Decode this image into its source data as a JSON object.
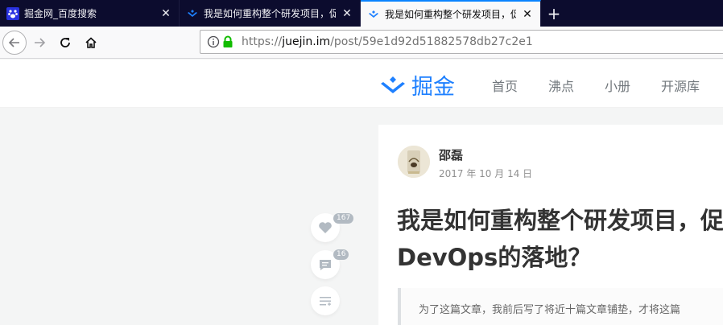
{
  "browser": {
    "tabs": [
      {
        "title": "掘金网_百度搜索",
        "favicon": "baidu-paw-icon",
        "active": false
      },
      {
        "title": "我是如何重构整个研发项目，促",
        "favicon": "juejin-icon",
        "active": false
      },
      {
        "title": "我是如何重构整个研发项目，促",
        "favicon": "juejin-icon",
        "active": true
      }
    ],
    "close_glyph": "✕",
    "new_tab_glyph": "+",
    "url_prefix": "https://",
    "url_domain": "juejin.im",
    "url_path": "/post/59e1d92d51882578db27c2e1"
  },
  "site": {
    "logo_text": "掘金",
    "nav": [
      "首页",
      "沸点",
      "小册",
      "开源库"
    ],
    "brand_color": "#1e80ff"
  },
  "sidebar": {
    "like_count": "167",
    "comment_count": "16"
  },
  "article": {
    "author": "邵磊",
    "date": "2017 年 10 月 14 日",
    "title_line1": "我是如何重构整个研发项目，促",
    "title_line2": "DevOps的落地？",
    "quote": "为了这篇文章，我前后写了将近十篇文章铺垫，才将这篇"
  }
}
